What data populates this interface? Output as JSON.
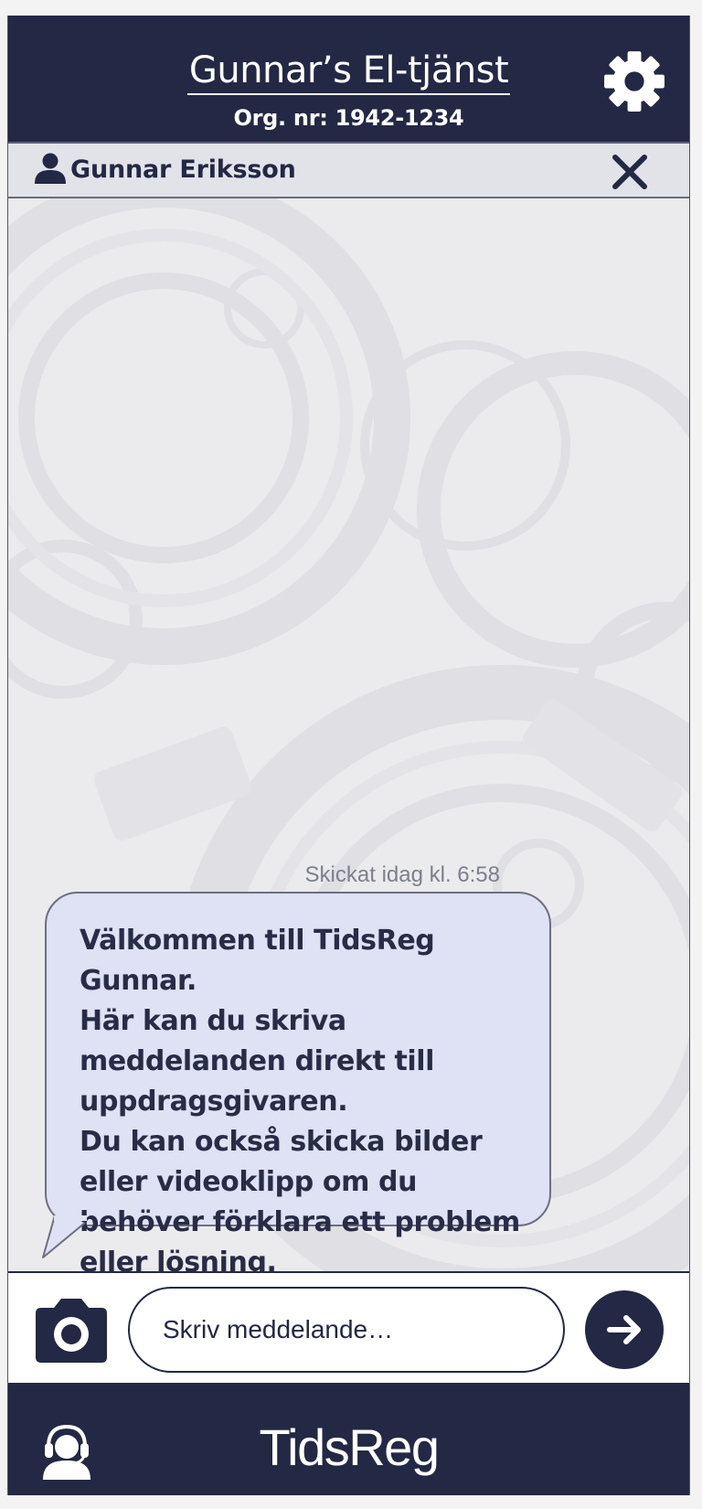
{
  "header": {
    "title": "Gunnar’s El-tjänst",
    "org_number": "Org. nr: 1942-1234",
    "settings_icon": "gear-icon"
  },
  "user": {
    "name": "Gunnar Eriksson",
    "avatar_icon": "user-icon",
    "close_icon": "close-icon"
  },
  "chat": {
    "messages": [
      {
        "timestamp": "Skickat idag kl. 6:58",
        "text": "Välkommen till TidsReg Gunnar.\nHär kan du skriva meddelanden direkt till uppdragsgivaren.\nDu kan också skicka bilder eller videoklipp om du behöver förklara ett problem eller lösning."
      }
    ]
  },
  "composer": {
    "placeholder": "Skriv meddelande…",
    "value": "",
    "camera_icon": "camera-icon",
    "send_icon": "arrow-right-icon"
  },
  "footer": {
    "brand": "TidsReg",
    "support_icon": "headset-icon"
  },
  "colors": {
    "navy": "#232844",
    "bubble": "#dfe1f4",
    "page_bg": "#f3f3f3"
  }
}
